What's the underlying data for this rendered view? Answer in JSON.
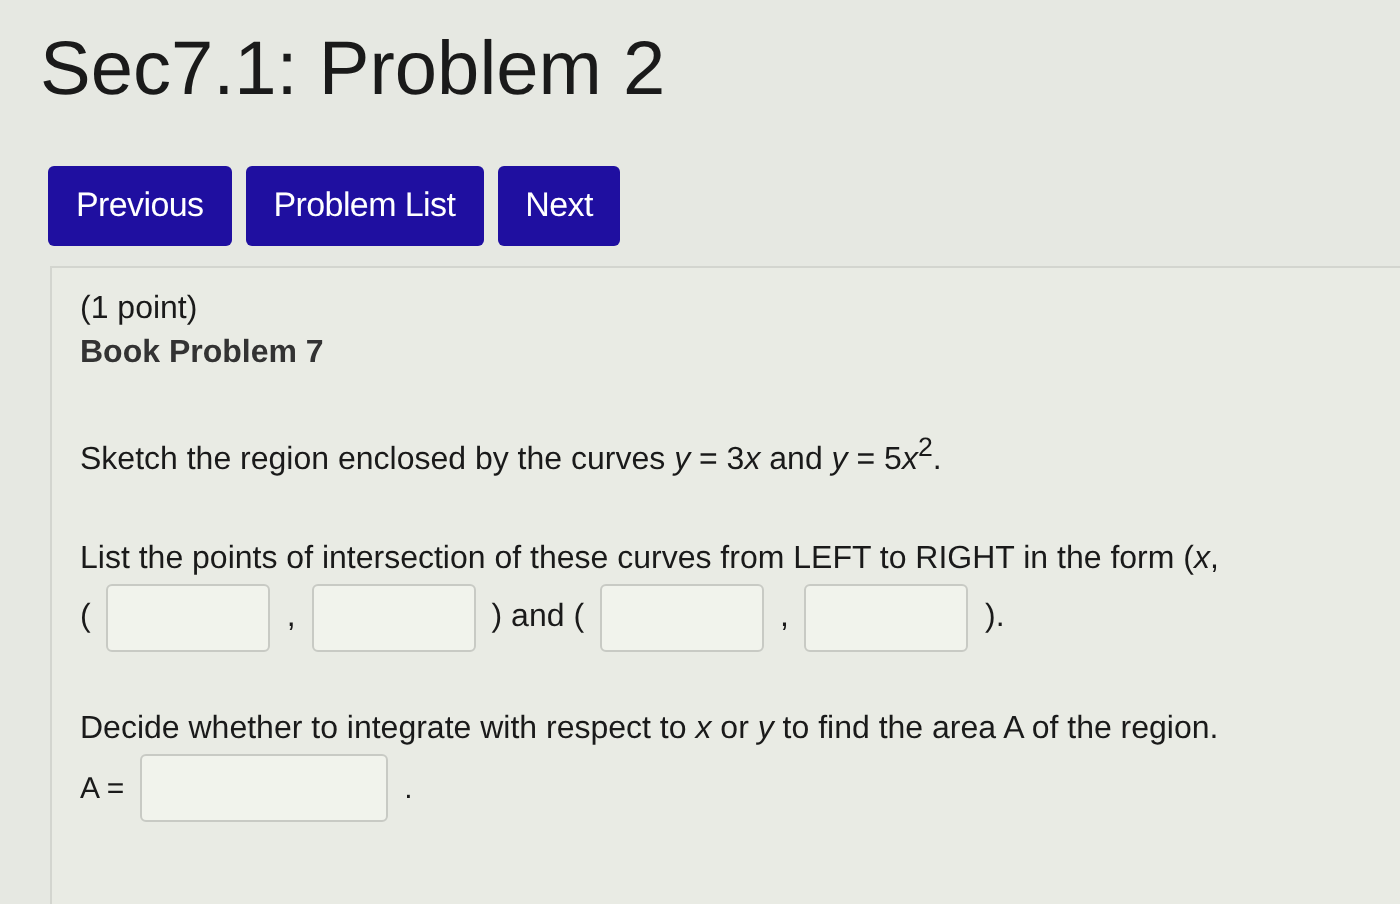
{
  "title": "Sec7.1: Problem 2",
  "nav_buttons": [
    "Previous",
    "Problem List",
    "Next"
  ],
  "problem": {
    "points": "(1 point)",
    "heading": "Book Problem 7",
    "statement": [
      {
        "kind": "text",
        "text": "Sketch the region enclosed by the curves "
      },
      {
        "kind": "var",
        "text": "y"
      },
      {
        "kind": "text",
        "text": " = 3"
      },
      {
        "kind": "var",
        "text": "x"
      },
      {
        "kind": "text",
        "text": " and "
      },
      {
        "kind": "var",
        "text": "y"
      },
      {
        "kind": "text",
        "text": " = 5"
      },
      {
        "kind": "var",
        "text": "x"
      },
      {
        "kind": "sup",
        "text": "2"
      },
      {
        "kind": "text",
        "text": "."
      }
    ],
    "instruction": "List the points of intersection of these curves from LEFT to RIGHT in the form (*x*,",
    "answer_line": [
      {
        "kind": "text",
        "text": "("
      },
      {
        "kind": "field"
      },
      {
        "kind": "text",
        "text": ","
      },
      {
        "kind": "field"
      },
      {
        "kind": "text",
        "text": ") and ("
      },
      {
        "kind": "field"
      },
      {
        "kind": "text",
        "text": ","
      },
      {
        "kind": "field"
      },
      {
        "kind": "text",
        "text": ")."
      }
    ],
    "decide": "Decide whether to integrate with respect to *x* or *y* to find the area A of the region.",
    "area_line": [
      {
        "kind": "text",
        "text": "A ="
      },
      {
        "kind": "field"
      },
      {
        "kind": "text",
        "text": "."
      }
    ]
  }
}
